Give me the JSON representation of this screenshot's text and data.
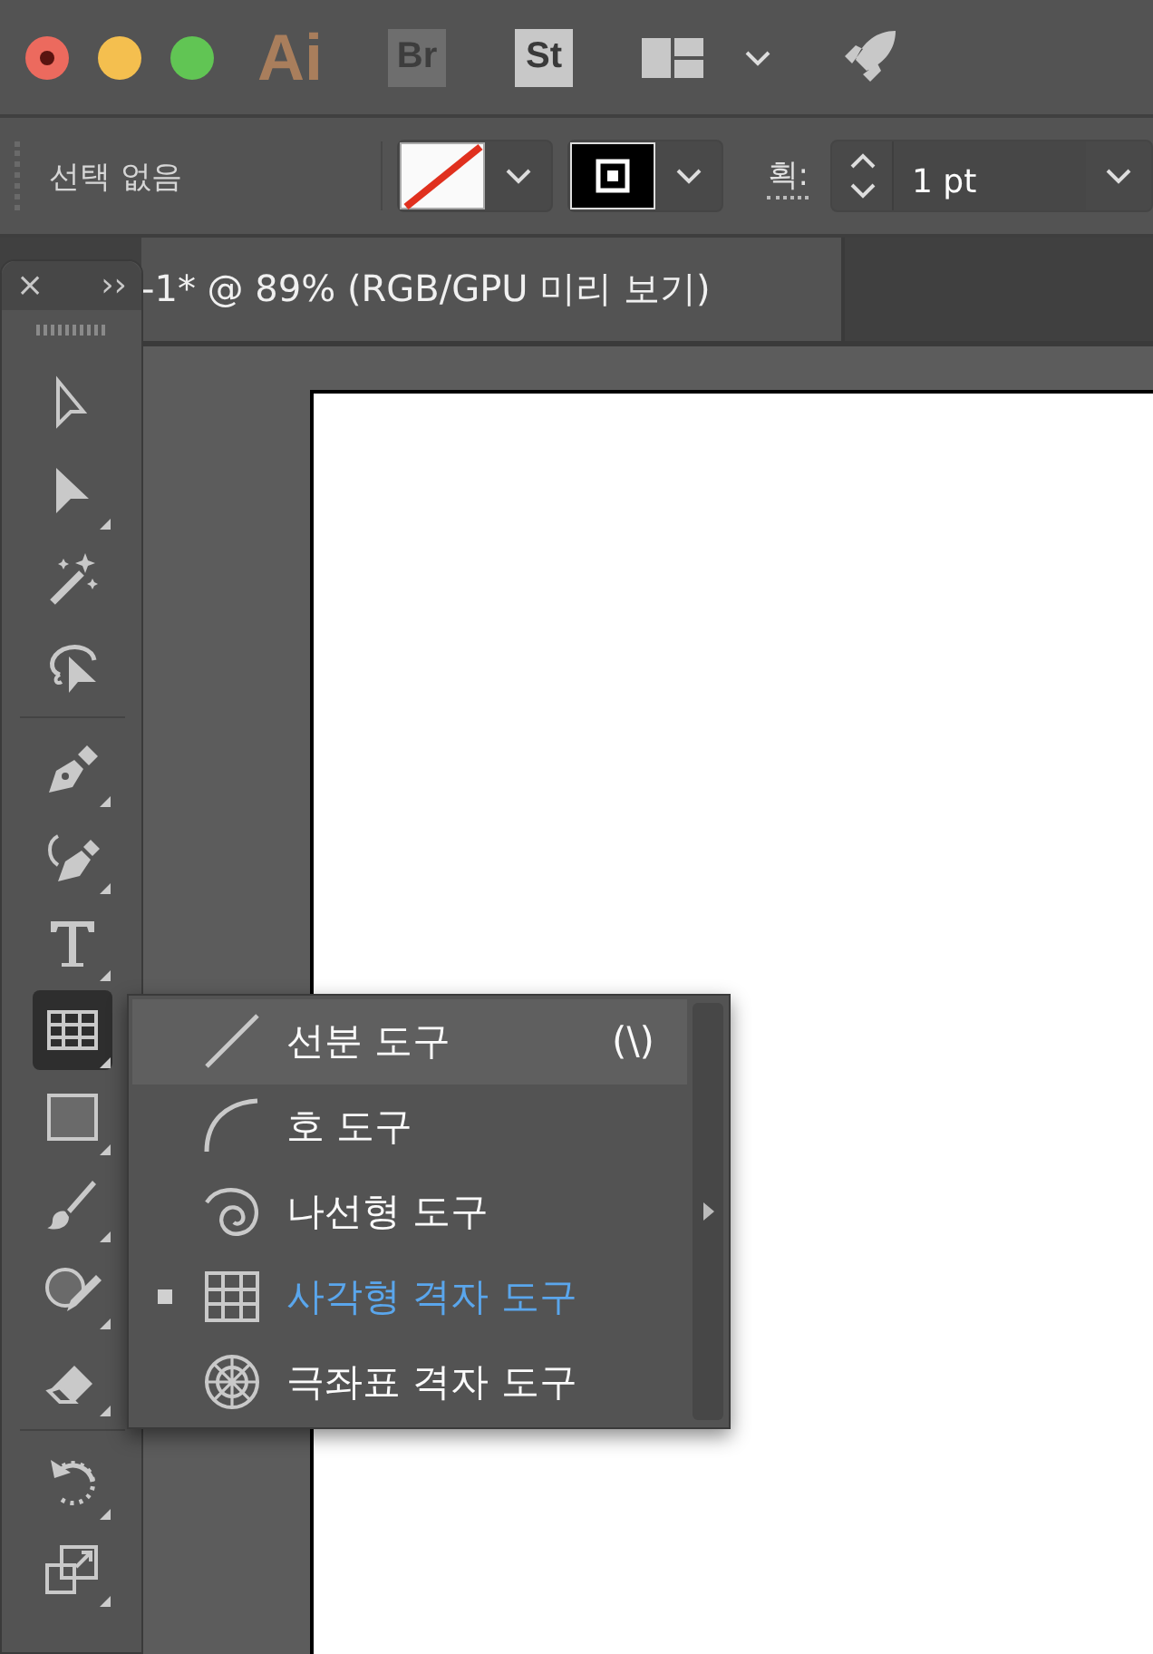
{
  "app_bar": {
    "app_logo": "Ai",
    "bridge_label": "Br",
    "stock_label": "St"
  },
  "control_bar": {
    "selection": "선택 없음",
    "stroke_label": "획:",
    "stroke_weight": "1 pt"
  },
  "document_tab": {
    "title": "-1* @ 89% (RGB/GPU 미리 보기)"
  },
  "toolbox": {
    "close": "×",
    "expand": "››",
    "tools": [
      {
        "kind": "select",
        "flyout": false,
        "selected": false,
        "group_end": false
      },
      {
        "kind": "direct",
        "flyout": true,
        "selected": false,
        "group_end": false
      },
      {
        "kind": "wand",
        "flyout": false,
        "selected": false,
        "group_end": false
      },
      {
        "kind": "lasso",
        "flyout": false,
        "selected": false,
        "group_end": true
      },
      {
        "kind": "pen",
        "flyout": true,
        "selected": false,
        "group_end": false
      },
      {
        "kind": "curvature",
        "flyout": true,
        "selected": false,
        "group_end": false
      },
      {
        "kind": "type",
        "flyout": true,
        "selected": false,
        "group_end": false
      },
      {
        "kind": "grid",
        "flyout": true,
        "selected": true,
        "group_end": false
      },
      {
        "kind": "rect",
        "flyout": true,
        "selected": false,
        "group_end": false
      },
      {
        "kind": "brush",
        "flyout": true,
        "selected": false,
        "group_end": false
      },
      {
        "kind": "shaper",
        "flyout": true,
        "selected": false,
        "group_end": false
      },
      {
        "kind": "eraser",
        "flyout": true,
        "selected": false,
        "group_end": true
      },
      {
        "kind": "rotate",
        "flyout": true,
        "selected": false,
        "group_end": false
      },
      {
        "kind": "scale",
        "flyout": true,
        "selected": false,
        "group_end": false
      }
    ]
  },
  "flyout_menu": {
    "items": [
      {
        "kind": "line",
        "label": "선분 도구",
        "shortcut": "(\\)",
        "highlighted": true,
        "selected": false
      },
      {
        "kind": "arc",
        "label": "호 도구",
        "highlighted": false,
        "selected": false
      },
      {
        "kind": "spiral",
        "label": "나선형 도구",
        "highlighted": false,
        "selected": false
      },
      {
        "kind": "grid",
        "label": "사각형 격자 도구",
        "highlighted": false,
        "selected": true
      },
      {
        "kind": "polar",
        "label": "극좌표 격자 도구",
        "highlighted": false,
        "selected": false
      }
    ]
  }
}
